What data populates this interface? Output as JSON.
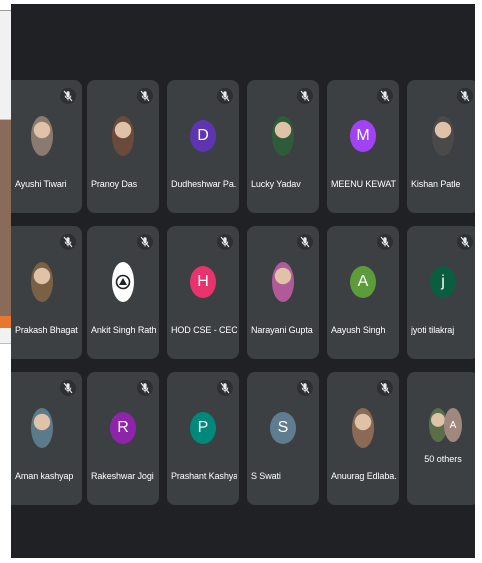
{
  "participants": [
    {
      "name": "Ayushi Tiwari",
      "initial": "",
      "color": "#8a7a6f",
      "photo": true
    },
    {
      "name": "Pranoy Das",
      "initial": "",
      "color": "#6a4a3a",
      "photo": true
    },
    {
      "name": "Dudheshwar Pa...",
      "initial": "D",
      "color": "#5e35b1",
      "photo": false
    },
    {
      "name": "Lucky Yadav",
      "initial": "",
      "color": "#2e5b3a",
      "photo": true
    },
    {
      "name": "MEENU KEWAT",
      "initial": "M",
      "color": "#a142f4",
      "photo": false
    },
    {
      "name": "Kishan Patle",
      "initial": "",
      "color": "#4a4a4a",
      "photo": true
    },
    {
      "name": "Prakash Bhagat",
      "initial": "",
      "color": "#7a6045",
      "photo": true
    },
    {
      "name": "Ankit Singh Rath...",
      "initial": "",
      "color": "#ffffff",
      "photo": true
    },
    {
      "name": "HOD CSE - CEC",
      "initial": "H",
      "color": "#e8336d",
      "photo": false
    },
    {
      "name": "Narayani Gupta",
      "initial": "",
      "color": "#b05a9a",
      "photo": true
    },
    {
      "name": "Aayush Singh",
      "initial": "A",
      "color": "#5d9c3a",
      "photo": false
    },
    {
      "name": "jyoti tilakraj",
      "initial": "j",
      "color": "#0b5d3f",
      "photo": false
    },
    {
      "name": "Aman kashyap",
      "initial": "",
      "color": "#5b7a8a",
      "photo": true
    },
    {
      "name": "Rakeshwar Jogi",
      "initial": "R",
      "color": "#8e24aa",
      "photo": false
    },
    {
      "name": "Prashant Kashyap",
      "initial": "P",
      "color": "#00897b",
      "photo": false
    },
    {
      "name": "S Swati",
      "initial": "S",
      "color": "#5f7d8e",
      "photo": false
    },
    {
      "name": "Anuurag Edlaba...",
      "initial": "",
      "color": "#8a6a55",
      "photo": true
    }
  ],
  "others": {
    "label": "50 others",
    "avatar_initial": "A",
    "avatar_color": "#a1887f",
    "avatar_photo_color": "#5a6e4a"
  },
  "colors": {
    "background": "#202124",
    "tile": "#3c4043"
  }
}
